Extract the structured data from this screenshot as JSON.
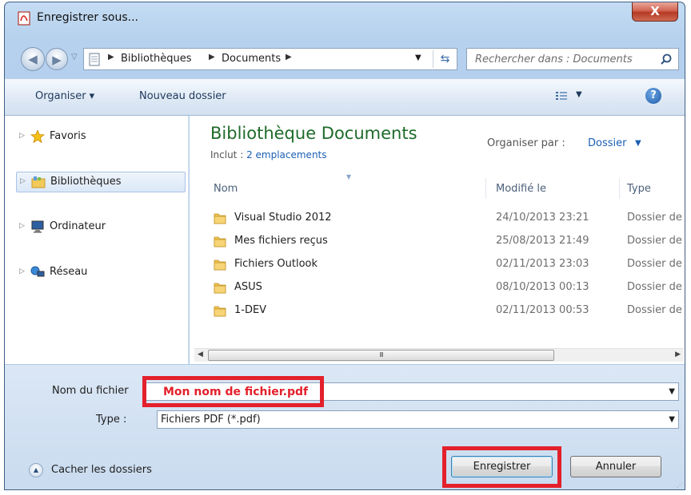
{
  "window": {
    "title": "Enregistrer sous...",
    "close_label": "X"
  },
  "address": {
    "crumbs": [
      "Bibliothèques",
      "Documents"
    ],
    "search_placeholder": "Rechercher dans : Documents"
  },
  "toolbar": {
    "organize_label": "Organiser ▾",
    "new_folder_label": "Nouveau dossier",
    "help_label": "?"
  },
  "nav": {
    "items": [
      {
        "label": "Favoris",
        "icon": "star-icon"
      },
      {
        "label": "Bibliothèques",
        "icon": "libraries-icon",
        "selected": true
      },
      {
        "label": "Ordinateur",
        "icon": "computer-icon"
      },
      {
        "label": "Réseau",
        "icon": "network-icon"
      }
    ]
  },
  "library": {
    "title": "Bibliothèque Documents",
    "includes_prefix": "Inclut : ",
    "includes_link": "2 emplacements",
    "arrange_label": "Organiser par :",
    "arrange_value": "Dossier"
  },
  "columns": {
    "name": "Nom",
    "modified": "Modifié le",
    "type": "Type"
  },
  "files": [
    {
      "name": "Visual Studio 2012",
      "date": "24/10/2013 23:21",
      "type": "Dossier de"
    },
    {
      "name": "Mes fichiers reçus",
      "date": "25/08/2013 21:49",
      "type": "Dossier de"
    },
    {
      "name": "Fichiers Outlook",
      "date": "02/11/2013 23:03",
      "type": "Dossier de"
    },
    {
      "name": "ASUS",
      "date": "08/10/2013 00:13",
      "type": "Dossier de"
    },
    {
      "name": "1-DEV",
      "date": "02/11/2013 00:53",
      "type": "Dossier de"
    }
  ],
  "scroll": {
    "thumb_label": "III"
  },
  "form": {
    "filename_label": "Nom du fichier",
    "filename_value": "Mon nom de fichier.pdf",
    "type_label": "Type :",
    "type_value": "Fichiers PDF (*.pdf)",
    "hide_folders_label": "Cacher les dossiers",
    "save_label": "Enregistrer",
    "cancel_label": "Annuler"
  },
  "colors": {
    "highlight": "#e3202b",
    "library_title": "#1e6b2a",
    "link": "#1b5fb5"
  }
}
